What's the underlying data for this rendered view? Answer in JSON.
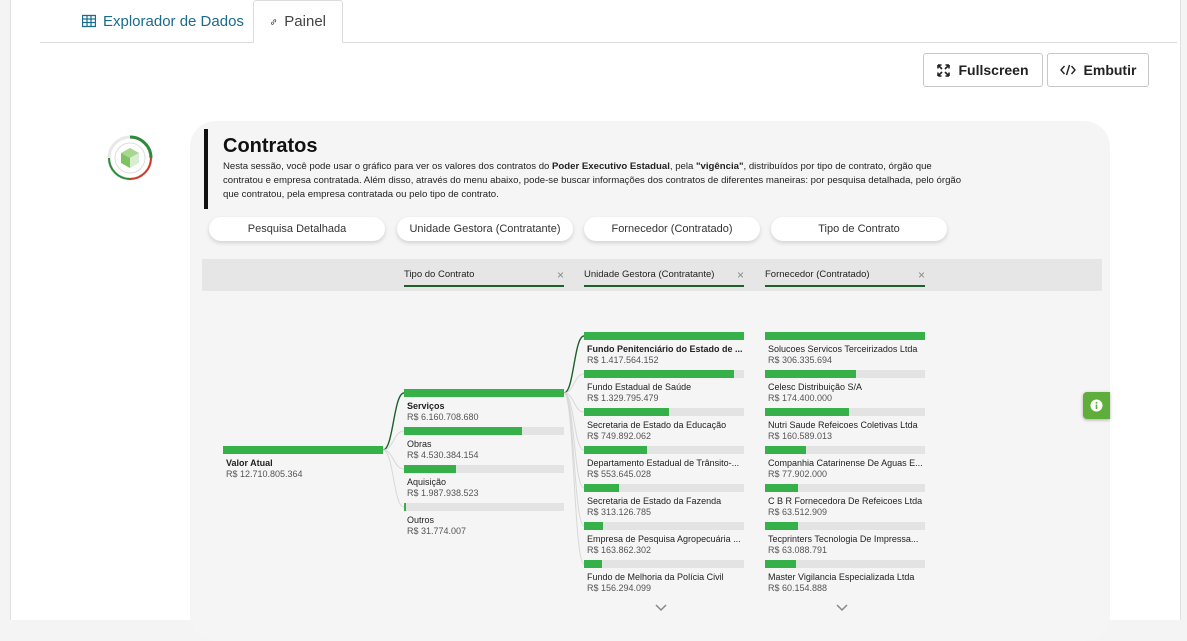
{
  "tabs": [
    {
      "label": "Explorador de Dados",
      "icon": "table-icon"
    },
    {
      "label": "Painel",
      "icon": "link-icon"
    }
  ],
  "actions": {
    "fullscreen": "Fullscreen",
    "embed": "Embutir"
  },
  "panel": {
    "title": "Contratos",
    "desc_p1": "Nesta sessão, você pode usar o gráfico para ver os valores dos contratos do ",
    "desc_b1": "Poder Executivo Estadual",
    "desc_p2": ", pela ",
    "desc_b2": "\"vigência\"",
    "desc_p3": ", distribuídos por tipo de contrato, órgão que contratou e empresa contratada. Além disso, através do menu abaixo, pode-se buscar informações dos contratos de diferentes maneiras: por pesquisa detalhada, pelo órgão que contratou, pela empresa contratada ou pelo tipo de contrato."
  },
  "menu": [
    "Pesquisa Detalhada",
    "Unidade Gestora (Contratante)",
    "Fornecedor (Contratado)",
    "Tipo de Contrato"
  ],
  "columns": [
    "Tipo do Contrato",
    "Unidade Gestora (Contratante)",
    "Fornecedor (Contratado)"
  ],
  "root": {
    "name": "Valor Atual",
    "value": "R$ 12.710.805.364",
    "fraction": 1.0
  },
  "tipo": [
    {
      "name": "Serviços",
      "value": "R$ 6.160.708.680",
      "fraction": 1.0,
      "bold": true
    },
    {
      "name": "Obras",
      "value": "R$ 4.530.384.154",
      "fraction": 0.735
    },
    {
      "name": "Aquisição",
      "value": "R$ 1.987.938.523",
      "fraction": 0.323
    },
    {
      "name": "Outros",
      "value": "R$ 31.774.007",
      "fraction": 0.005
    }
  ],
  "unidade": [
    {
      "name": "Fundo Penitenciário do Estado de ...",
      "value": "R$ 1.417.564.152",
      "fraction": 1.0,
      "bold": true
    },
    {
      "name": "Fundo Estadual de Saúde",
      "value": "R$ 1.329.795.479",
      "fraction": 0.938
    },
    {
      "name": "Secretaria de Estado da Educação",
      "value": "R$ 749.892.062",
      "fraction": 0.529
    },
    {
      "name": "Departamento Estadual de Trânsito-...",
      "value": "R$ 553.645.028",
      "fraction": 0.391
    },
    {
      "name": "Secretaria de Estado da Fazenda",
      "value": "R$ 313.126.785",
      "fraction": 0.221
    },
    {
      "name": "Empresa de Pesquisa Agropecuária ...",
      "value": "R$ 163.862.302",
      "fraction": 0.116
    },
    {
      "name": "Fundo de Melhoria da Polícia Civil",
      "value": "R$ 156.294.099",
      "fraction": 0.11
    }
  ],
  "fornecedor": [
    {
      "name": "Solucoes Servicos Terceirizados Ltda",
      "value": "R$ 306.335.694",
      "fraction": 1.0
    },
    {
      "name": "Celesc Distribuição S/A",
      "value": "R$ 174.400.000",
      "fraction": 0.569
    },
    {
      "name": "Nutri Saude Refeicoes Coletivas Ltda",
      "value": "R$ 160.589.013",
      "fraction": 0.524
    },
    {
      "name": "Companhia Catarinense De Aguas E...",
      "value": "R$ 77.902.000",
      "fraction": 0.254
    },
    {
      "name": "C B R Fornecedora De Refeicoes Ltda",
      "value": "R$ 63.512.909",
      "fraction": 0.207
    },
    {
      "name": "Tecprinters Tecnologia De Impressa...",
      "value": "R$ 63.088.791",
      "fraction": 0.206
    },
    {
      "name": "Master Vigilancia Especializada Ltda",
      "value": "R$ 60.154.888",
      "fraction": 0.196
    }
  ],
  "colors": {
    "bar": "#36b048",
    "track": "#e3e3e3",
    "accent": "#1a6b8c",
    "info": "#5fae3c"
  }
}
